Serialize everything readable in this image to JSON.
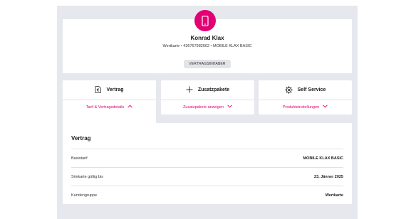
{
  "profile": {
    "name": "Konrad Klax",
    "card_type": "Wertkarte",
    "number": "436767982602",
    "tariff": "MOBILE KLAX BASIC",
    "role_badge": "VERTRAGSINHABER",
    "avatar_icon": "smartphone-icon"
  },
  "tabs": [
    {
      "title": "Vertrag",
      "icon": "contract-document-icon",
      "link": "Tarif & Vertragsdetails",
      "chevron": "chevron-up-icon",
      "active": true
    },
    {
      "title": "Zusatzpakete",
      "icon": "plus-icon",
      "link": "Zusatzpakete anzeigen",
      "chevron": "chevron-down-icon",
      "active": false
    },
    {
      "title": "Self Service",
      "icon": "gear-icon",
      "link": "Produkteinstellungen",
      "chevron": "chevron-down-icon",
      "active": false
    }
  ],
  "contract": {
    "title": "Vertrag",
    "rows": [
      {
        "label": "Basistarif",
        "value": "MOBILE KLAX BASIC"
      },
      {
        "label": "Simkarte gültig bis",
        "value": "23. Jänner 2025"
      },
      {
        "label": "Kundengruppe",
        "value": "Wertkarte"
      }
    ]
  },
  "colors": {
    "brand": "#e20074",
    "background": "#e6e8ee",
    "card": "#ffffff"
  }
}
